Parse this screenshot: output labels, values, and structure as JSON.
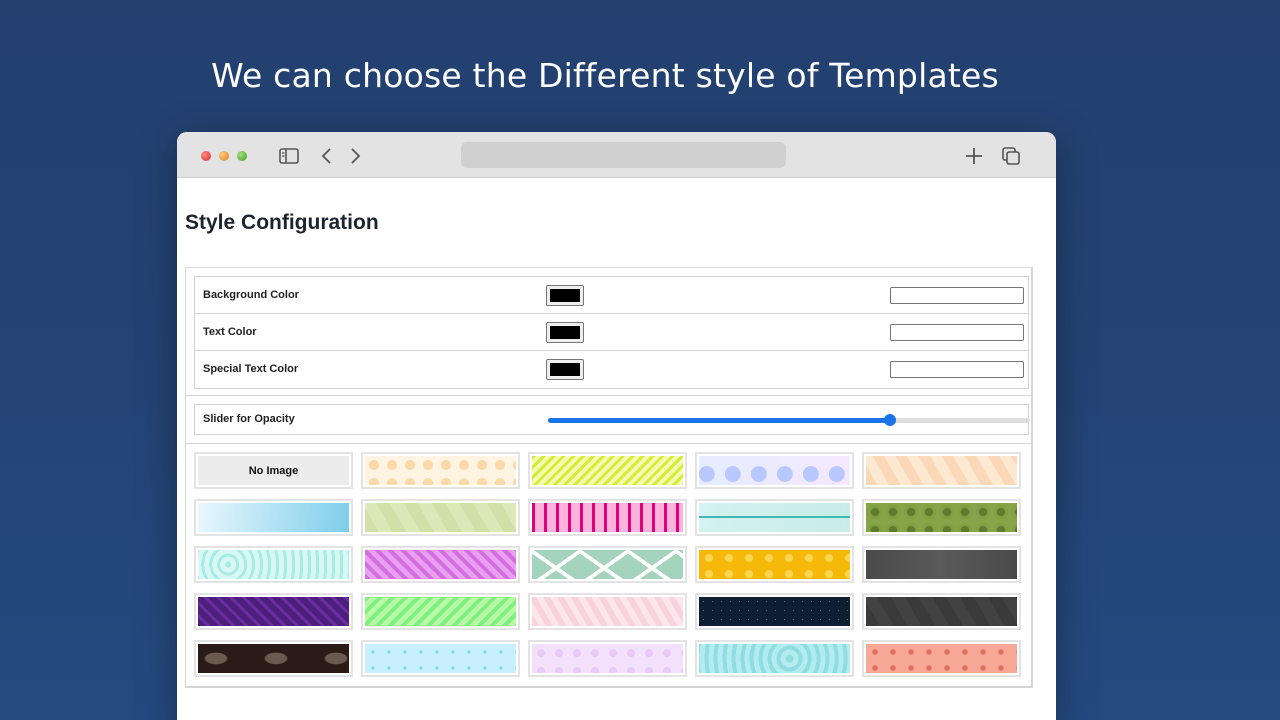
{
  "headline": "We can choose the Different style of Templates",
  "browser": {
    "address": ""
  },
  "page": {
    "title": "Style Configuration"
  },
  "color_settings": [
    {
      "label": "Background Color",
      "value": "#000000",
      "text": ""
    },
    {
      "label": "Text Color",
      "value": "#000000",
      "text": ""
    },
    {
      "label": "Special Text Color",
      "value": "#000000",
      "text": ""
    }
  ],
  "opacity": {
    "label": "Slider for Opacity",
    "value": 0.71
  },
  "templates": {
    "no_image_label": "No Image",
    "selected": "No Image",
    "patterns": [
      "peach-dots",
      "lime-halftone",
      "lavender-bubbles",
      "peach-waves",
      "sky-watercolor",
      "sage-hexagons",
      "pink-pixels",
      "teal-circuit",
      "olive-floral",
      "aqua-doodles",
      "magenta-waves",
      "mint-lattice",
      "yellow-bubbles",
      "charcoal-plain",
      "purple-zigzag",
      "green-chevron",
      "pink-lines",
      "navy-starfield",
      "dark-hexagons",
      "brown-ghosts",
      "cyan-doodles",
      "lilac-lace",
      "turquoise-sea",
      "coral-food"
    ]
  },
  "colors": {
    "background": "#244476",
    "accent": "#1a73e8"
  }
}
